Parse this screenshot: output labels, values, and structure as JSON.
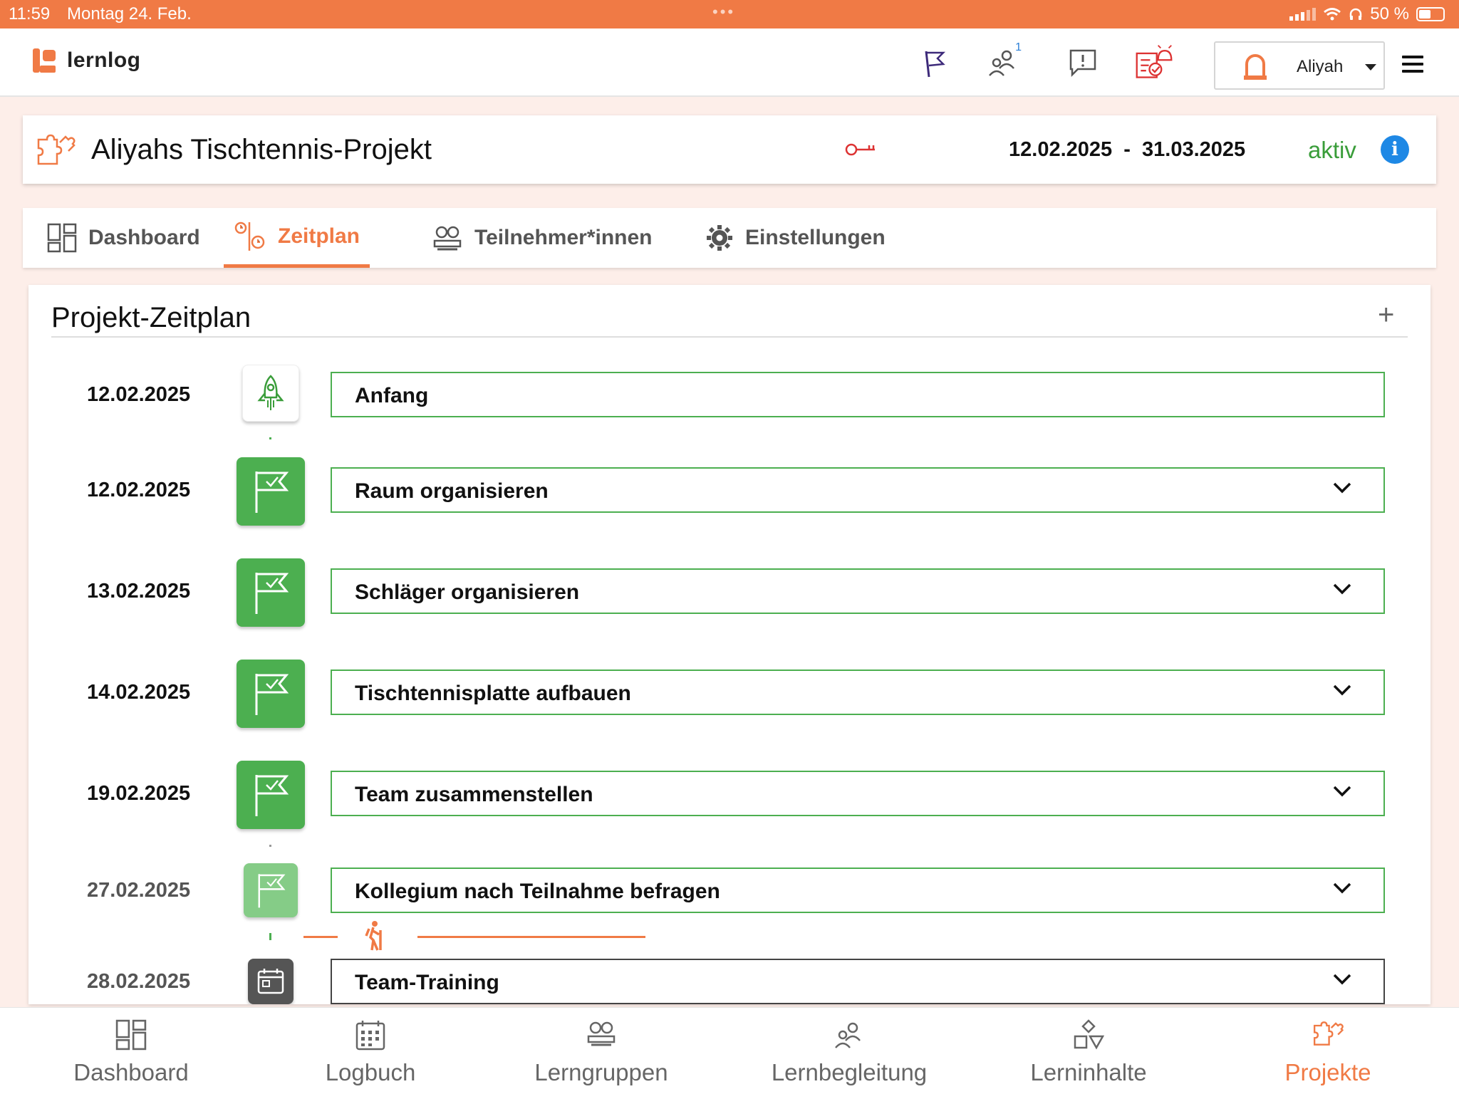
{
  "statusbar": {
    "time": "11:59",
    "date": "Montag 24. Feb.",
    "battery": "50 %"
  },
  "app": {
    "logo_text": "lernlog"
  },
  "header": {
    "user_name": "Aliyah",
    "notification_count": "1"
  },
  "project": {
    "title": "Aliyahs Tischtennis-Projekt",
    "date_range": "12.02.2025  -  31.03.2025",
    "status": "aktiv"
  },
  "tabs": [
    {
      "label": "Dashboard",
      "active": false
    },
    {
      "label": "Zeitplan",
      "active": true
    },
    {
      "label": "Teilnehmer*innen",
      "active": false
    },
    {
      "label": "Einstellungen",
      "active": false
    }
  ],
  "timeline": {
    "heading": "Projekt-Zeitplan",
    "add_label": "+",
    "items": [
      {
        "date": "12.02.2025",
        "label": "Anfang",
        "icon": "rocket-icon",
        "state": "start"
      },
      {
        "date": "12.02.2025",
        "label": "Raum organisieren",
        "icon": "flag-check-icon",
        "state": "done"
      },
      {
        "date": "13.02.2025",
        "label": "Schläger organisieren",
        "icon": "flag-check-icon",
        "state": "done"
      },
      {
        "date": "14.02.2025",
        "label": "Tischtennisplatte aufbauen",
        "icon": "flag-check-icon",
        "state": "done"
      },
      {
        "date": "19.02.2025",
        "label": "Team zusammenstellen",
        "icon": "flag-check-icon",
        "state": "done"
      },
      {
        "date": "27.02.2025",
        "label": "Kollegium nach Teilnahme befragen",
        "icon": "flag-check-icon",
        "state": "past"
      },
      {
        "date": "28.02.2025",
        "label": "Team-Training",
        "icon": "calendar-icon",
        "state": "upcoming"
      }
    ]
  },
  "bottom_nav": [
    {
      "label": "Dashboard",
      "icon": "dashboard-icon",
      "active": false
    },
    {
      "label": "Logbuch",
      "icon": "calendar-grid-icon",
      "active": false
    },
    {
      "label": "Lerngruppen",
      "icon": "group-icon",
      "active": false
    },
    {
      "label": "Lernbegleitung",
      "icon": "mentor-icon",
      "active": false
    },
    {
      "label": "Lerninhalte",
      "icon": "shapes-icon",
      "active": false
    },
    {
      "label": "Projekte",
      "icon": "puzzle-icon",
      "active": true
    }
  ],
  "colors": {
    "accent": "#f07a45",
    "success": "#4caf50",
    "info": "#1e88e5",
    "active_status": "#3a9d3a"
  }
}
